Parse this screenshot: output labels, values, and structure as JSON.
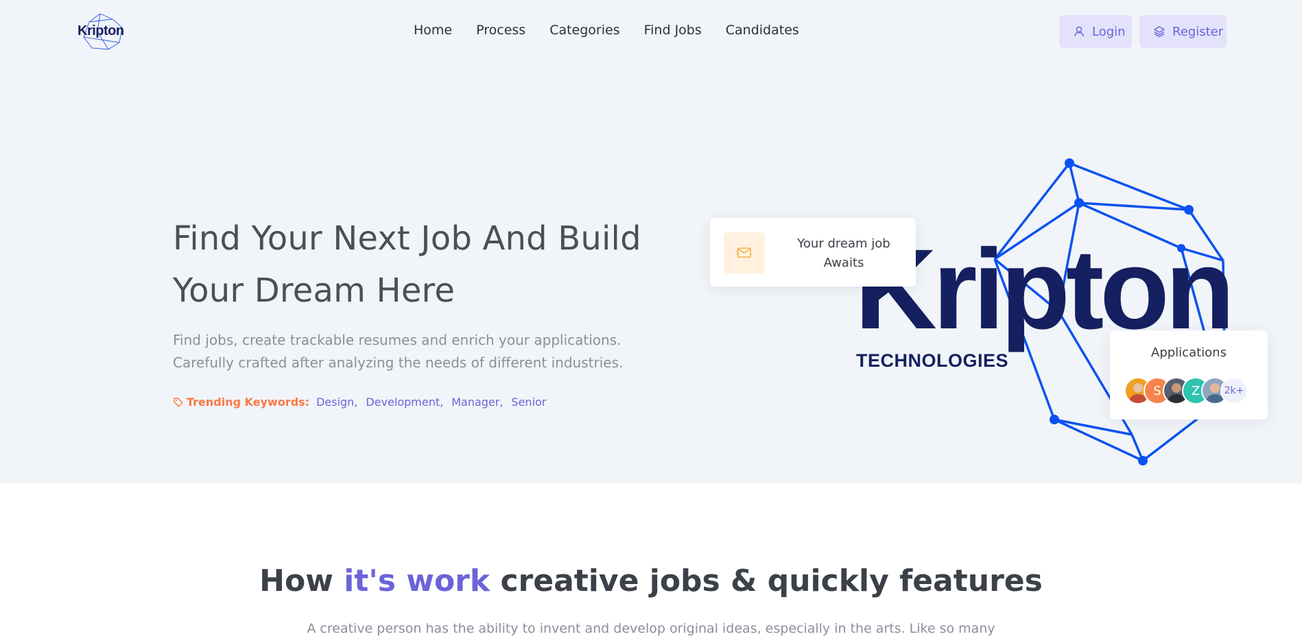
{
  "logo": {
    "text": "Kripton"
  },
  "nav": [
    "Home",
    "Process",
    "Categories",
    "Find Jobs",
    "Candidates"
  ],
  "auth": {
    "login": "Login",
    "register": "Register"
  },
  "hero": {
    "title_line1": "Find Your Next Job And Build",
    "title_line2": "Your Dream Here",
    "desc_line1": "Find jobs, create trackable resumes and enrich your applications.",
    "desc_line2": "Carefully crafted after analyzing the needs of different industries.",
    "trending_label": "Trending Keywords:",
    "keywords": [
      "Design,",
      "Development,",
      "Manager,",
      "Senior"
    ]
  },
  "illustration": {
    "brand": "Kripton",
    "brand_sub": "TECHNOLOGIES",
    "dream_card": {
      "line1": "Your dream job",
      "line2": "Awaits"
    },
    "apps_card": {
      "title": "Applications",
      "avatars": [
        {
          "initial": "",
          "color": "#f0a020"
        },
        {
          "initial": "S",
          "color": "#f4844c"
        },
        {
          "initial": "",
          "color": "#556070"
        },
        {
          "initial": "Z",
          "color": "#2ec4b0"
        },
        {
          "initial": "",
          "color": "#8fa6c0"
        }
      ],
      "more": "2k+"
    }
  },
  "section2": {
    "title_pre": "How ",
    "title_accent": "it's work",
    "title_post": " creative jobs & quickly features",
    "desc": "A creative person has the ability to invent and develop original ideas, especially in the arts. Like so many"
  },
  "colors": {
    "accent": "#6c63d8",
    "brand_navy": "#14205f",
    "network_blue": "#0a52f0",
    "trending": "#f97845",
    "hero_bg": "#f1f4f8"
  }
}
